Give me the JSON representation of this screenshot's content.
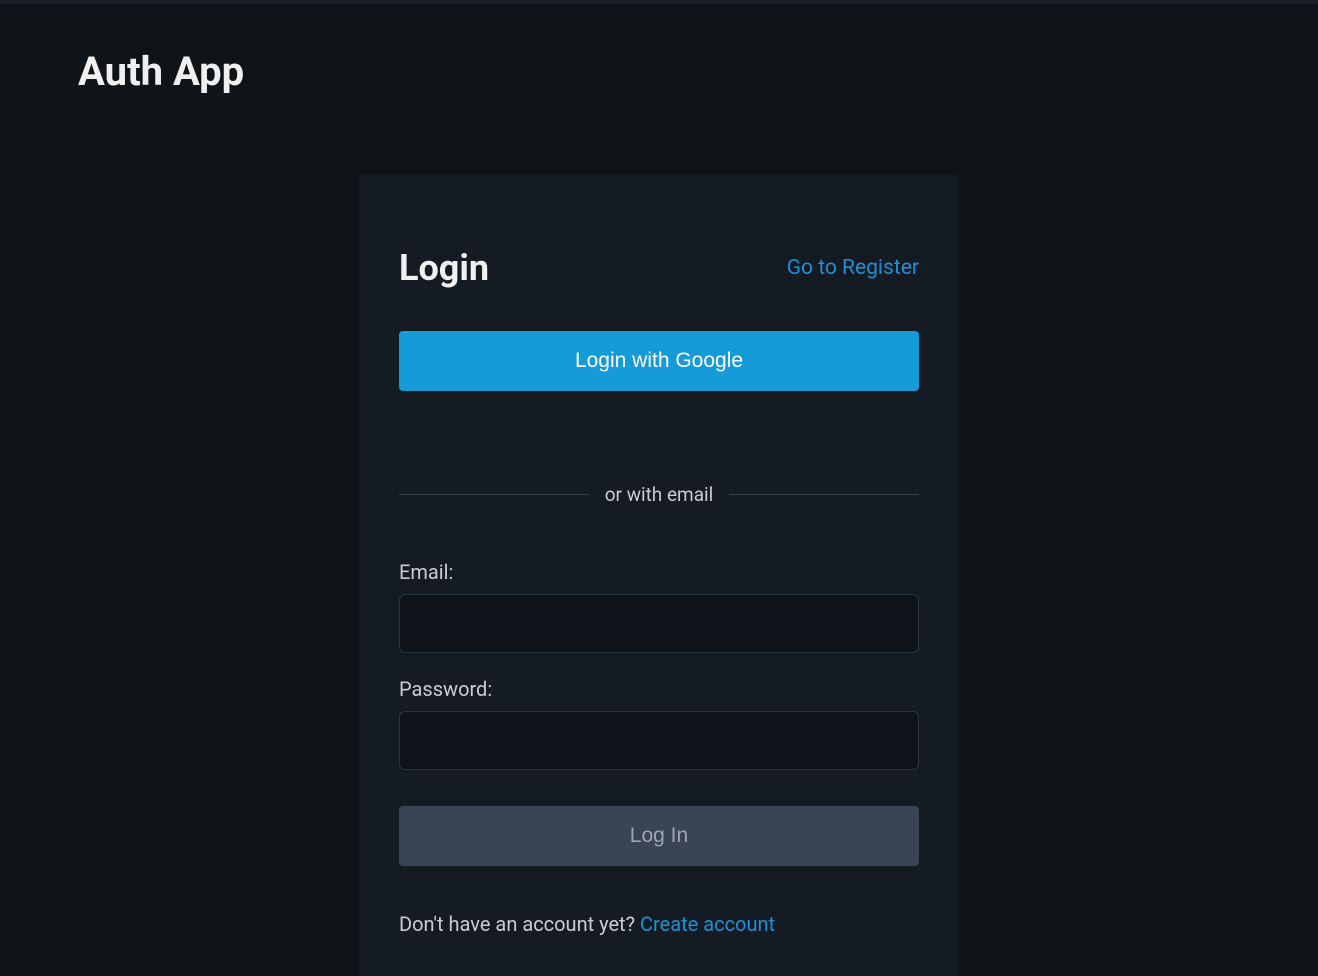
{
  "header": {
    "app_title": "Auth App"
  },
  "card": {
    "title": "Login",
    "register_link": "Go to Register",
    "google_button": "Login with Google",
    "divider_text": "or with email",
    "email_label": "Email:",
    "email_value": "",
    "password_label": "Password:",
    "password_value": "",
    "login_button": "Log In",
    "footer_prompt": "Don't have an account yet? ",
    "create_link": "Create account"
  }
}
